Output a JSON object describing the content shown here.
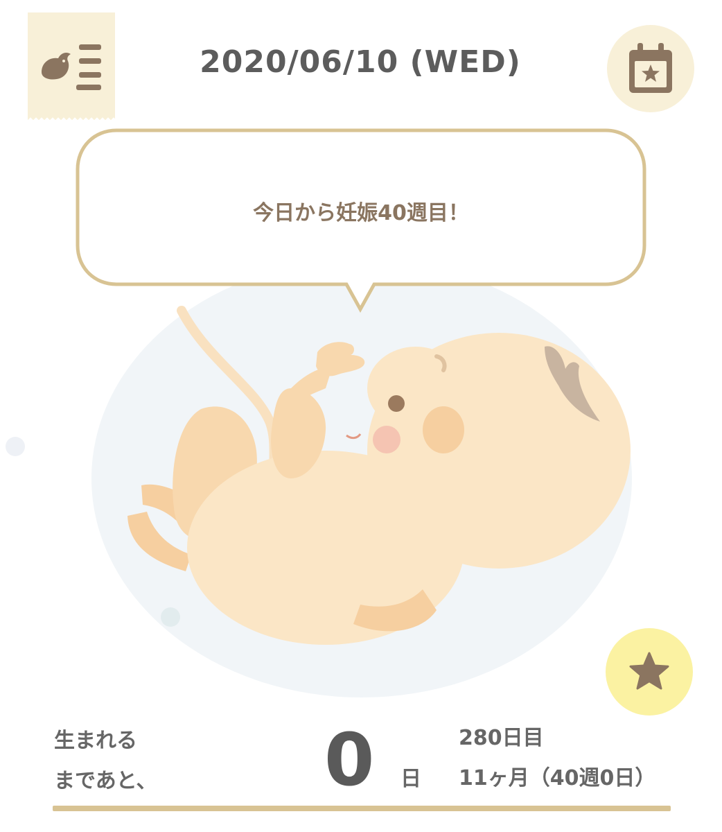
{
  "header": {
    "date": "2020/06/10 (WED)",
    "menu_icon": "bird-list-icon",
    "calendar_icon": "calendar-star-icon"
  },
  "bubble": {
    "message": "今日から妊娠40週目！"
  },
  "illustration": {
    "icon": "baby-in-womb-illustration"
  },
  "favorite": {
    "icon": "star-icon"
  },
  "countdown": {
    "label_line1": "生まれる",
    "label_line2": "まであと、",
    "days": "0",
    "unit": "日",
    "day_count": "280日目",
    "month_week": "11ヶ月（40週0日）"
  },
  "colors": {
    "accent_gold": "#d8c393",
    "cream": "#f8f0d8",
    "icon_brown": "#8b7560",
    "star_bg": "#fbf2a2"
  }
}
